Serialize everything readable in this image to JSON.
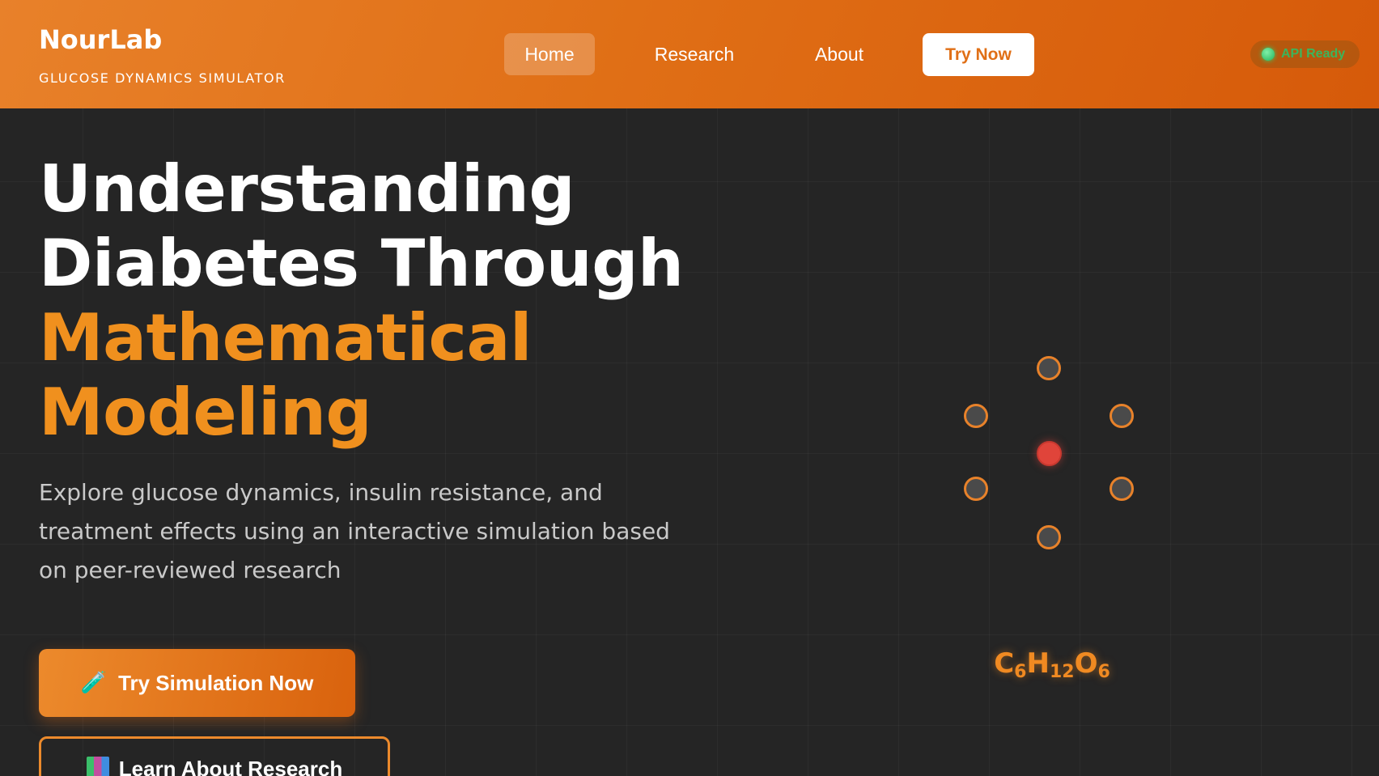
{
  "header": {
    "brand_name": "NourLab",
    "brand_subtitle": "GLUCOSE DYNAMICS SIMULATOR",
    "nav": {
      "home": "Home",
      "research": "Research",
      "about": "About",
      "try_now": "Try Now"
    },
    "api_status": "API Ready",
    "api_status_color": "#3cb55c"
  },
  "hero": {
    "title_line1": "Understanding",
    "title_line2": "Diabetes Through",
    "title_line3": "Mathematical",
    "title_line4": "Modeling",
    "description": "Explore glucose dynamics, insulin resistance, and treatment effects using an interactive simulation based on peer-reviewed research",
    "primary_button": {
      "icon": "test-tube-icon",
      "label": "Try Simulation Now"
    },
    "secondary_button": {
      "icon": "books-icon",
      "label": "Learn About Research"
    }
  },
  "molecule": {
    "formula": {
      "c": "C",
      "c_n": "6",
      "h": "H",
      "h_n": "12",
      "o": "O",
      "o_n": "6"
    }
  },
  "colors": {
    "brand_orange": "#e06f16",
    "accent_orange": "#f0901e",
    "background": "#252525",
    "center_atom": "#e0443a"
  }
}
